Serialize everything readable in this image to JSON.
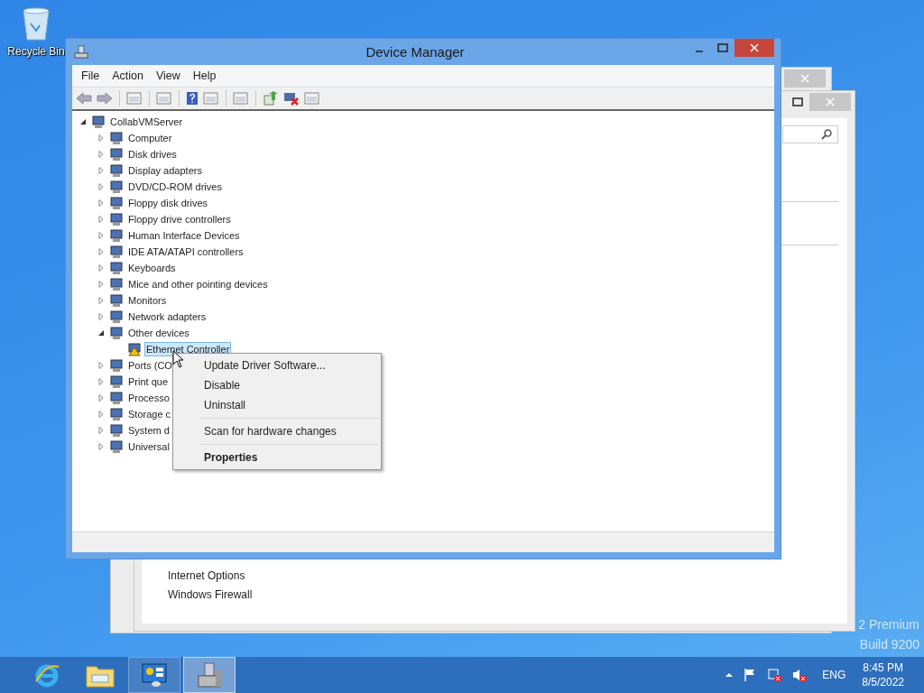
{
  "desktop": {
    "icons": [
      {
        "label": "Recycle Bin"
      }
    ],
    "watermark": [
      "2 Premium",
      "Build 9200"
    ]
  },
  "back_window": {
    "links": [
      "Internet Options",
      "Windows Firewall"
    ]
  },
  "window": {
    "title": "Device Manager",
    "menu": [
      "File",
      "Action",
      "View",
      "Help"
    ],
    "tree": {
      "label": "CollabVMServer",
      "expanded": true,
      "selected": false,
      "warning": false,
      "children": [
        {
          "label": "Computer",
          "expanded": false,
          "selected": false,
          "warning": false
        },
        {
          "label": "Disk drives",
          "expanded": false,
          "selected": false,
          "warning": false
        },
        {
          "label": "Display adapters",
          "expanded": false,
          "selected": false,
          "warning": false
        },
        {
          "label": "DVD/CD-ROM drives",
          "expanded": false,
          "selected": false,
          "warning": false
        },
        {
          "label": "Floppy disk drives",
          "expanded": false,
          "selected": false,
          "warning": false
        },
        {
          "label": "Floppy drive controllers",
          "expanded": false,
          "selected": false,
          "warning": false
        },
        {
          "label": "Human Interface Devices",
          "expanded": false,
          "selected": false,
          "warning": false
        },
        {
          "label": "IDE ATA/ATAPI controllers",
          "expanded": false,
          "selected": false,
          "warning": false
        },
        {
          "label": "Keyboards",
          "expanded": false,
          "selected": false,
          "warning": false
        },
        {
          "label": "Mice and other pointing devices",
          "expanded": false,
          "selected": false,
          "warning": false
        },
        {
          "label": "Monitors",
          "expanded": false,
          "selected": false,
          "warning": false
        },
        {
          "label": "Network adapters",
          "expanded": false,
          "selected": false,
          "warning": false
        },
        {
          "label": "Other devices",
          "expanded": true,
          "selected": false,
          "warning": false,
          "children": [
            {
              "label": "Ethernet Controller",
              "selected": true,
              "warning": true
            }
          ]
        },
        {
          "label": "Ports (CO",
          "expanded": false,
          "selected": false,
          "warning": false
        },
        {
          "label": "Print que",
          "expanded": false,
          "selected": false,
          "warning": false
        },
        {
          "label": "Processo",
          "expanded": false,
          "selected": false,
          "warning": false
        },
        {
          "label": "Storage c",
          "expanded": false,
          "selected": false,
          "warning": false
        },
        {
          "label": "System d",
          "expanded": false,
          "selected": false,
          "warning": false
        },
        {
          "label": "Universal",
          "expanded": false,
          "selected": false,
          "warning": false
        }
      ]
    }
  },
  "context_menu": [
    {
      "label": "Update Driver Software...",
      "default": false,
      "separator_before": false
    },
    {
      "label": "Disable",
      "default": false,
      "separator_before": false
    },
    {
      "label": "Uninstall",
      "default": false,
      "separator_before": false
    },
    {
      "label": "Scan for hardware changes",
      "default": false,
      "separator_before": true
    },
    {
      "label": "Properties",
      "default": true,
      "separator_before": true
    }
  ],
  "taskbar": {
    "apps": [
      {
        "kind": "browser",
        "selected": false
      },
      {
        "kind": "folder",
        "selected": false
      },
      {
        "kind": "panel",
        "selected": false
      },
      {
        "kind": "device",
        "selected": true
      }
    ],
    "tray": {
      "language": "ENG",
      "time": "8:45 PM",
      "date": "8/5/2022"
    }
  }
}
